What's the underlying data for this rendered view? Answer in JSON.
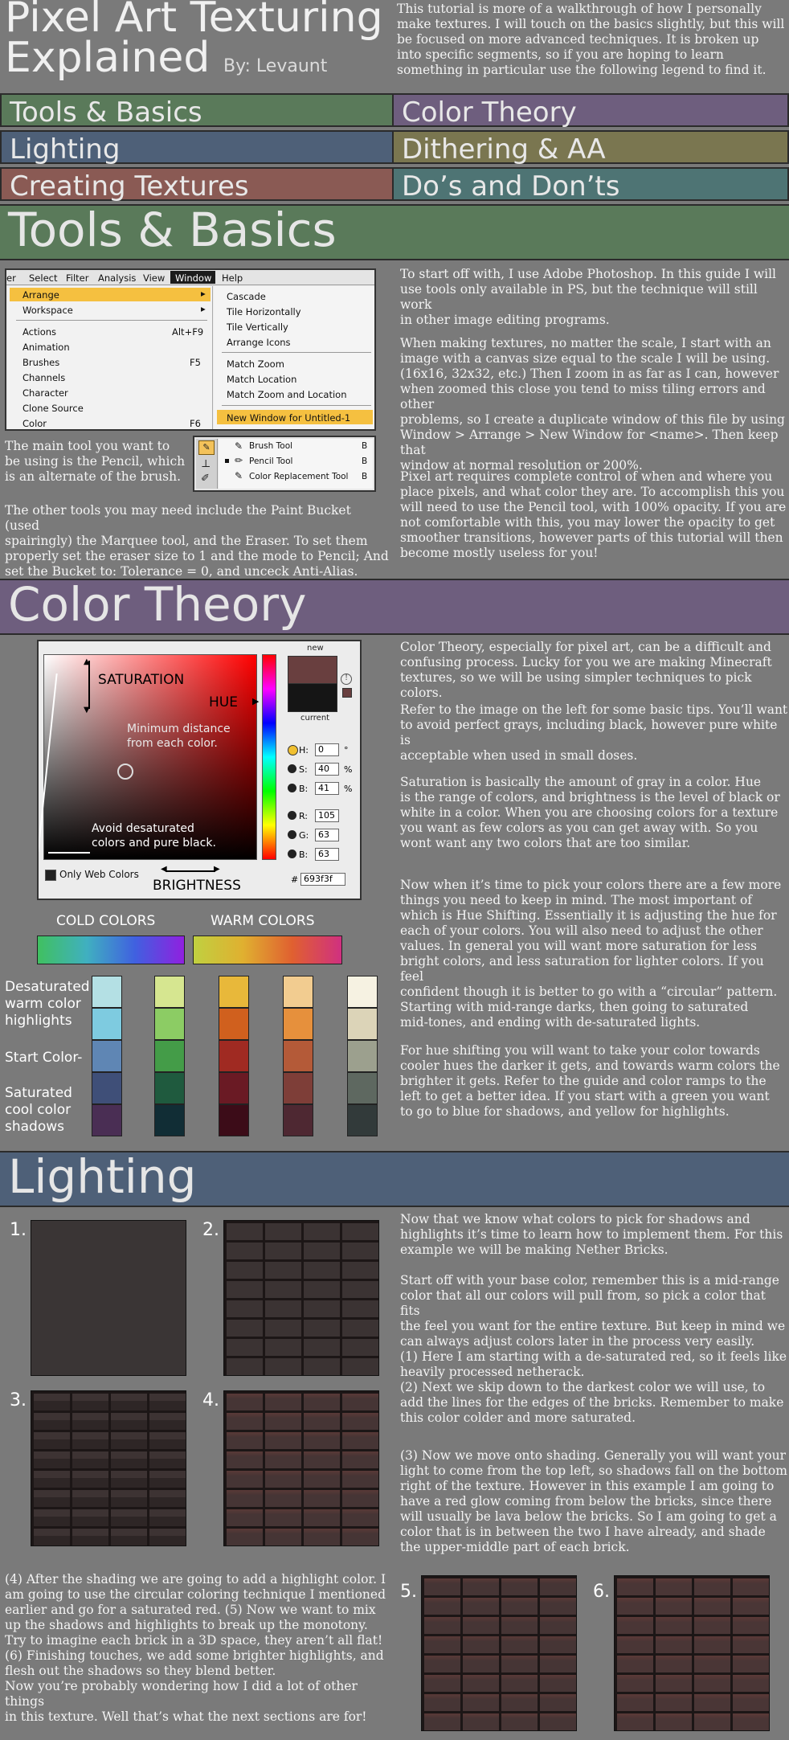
{
  "header": {
    "title_line1": "Pixel Art Texturing",
    "title_line2": "Explained",
    "author": "By: Levaunt",
    "intro": "This tutorial is more of a walkthrough of how I personally make textures. I will touch on the basics slightly, but this will be focused on more advanced techniques. It is broken up into specific segments, so if you are hoping to learn something in particular use the following legend to find it."
  },
  "legend": [
    {
      "label": "Tools & Basics",
      "color": "#5a7a5a"
    },
    {
      "label": "Color Theory",
      "color": "#6e5e7e"
    },
    {
      "label": "Lighting",
      "color": "#4e6078"
    },
    {
      "label": "Dithering & AA",
      "color": "#7a7650"
    },
    {
      "label": "Creating Textures",
      "color": "#8a5a54"
    },
    {
      "label": "Do’s and Don’ts",
      "color": "#4e7474"
    }
  ],
  "tools": {
    "heading": "Tools & Basics",
    "menubar": [
      "er",
      "Select",
      "Filter",
      "Analysis",
      "View",
      "Window",
      "Help"
    ],
    "left_menu": [
      {
        "label": "Arrange",
        "shortcut": ""
      },
      {
        "label": "Workspace",
        "shortcut": ""
      },
      {
        "label": "Actions",
        "shortcut": "Alt+F9"
      },
      {
        "label": "Animation",
        "shortcut": ""
      },
      {
        "label": "Brushes",
        "shortcut": "F5"
      },
      {
        "label": "Channels",
        "shortcut": ""
      },
      {
        "label": "Character",
        "shortcut": ""
      },
      {
        "label": "Clone Source",
        "shortcut": ""
      },
      {
        "label": "Color",
        "shortcut": "F6"
      }
    ],
    "submenu": [
      "Cascade",
      "Tile Horizontally",
      "Tile Vertically",
      "Arrange Icons",
      "Match Zoom",
      "Match Location",
      "Match Zoom and Location",
      "New Window for Untitled-1"
    ],
    "tool_list": [
      {
        "label": "Brush Tool",
        "key": "B"
      },
      {
        "label": "Pencil Tool",
        "key": "B"
      },
      {
        "label": "Color Replacement Tool",
        "key": "B"
      }
    ],
    "pencil_text": "The main tool you want to\nbe using is the Pencil, which\nis an alternate of the brush.",
    "other_tools": "The other tools you may need include the Paint Bucket (used\nspairingly) the Marquee tool, and the Eraser. To set them\nproperly set the eraser size to 1 and the mode to Pencil; And\nset the Bucket to: Tolerance = 0, and unceck Anti-Alias.",
    "right_p1": "To start off with, I use Adobe Photoshop. In this guide I will\nuse tools only available in PS, but the technique will still work\nin other image editing programs.",
    "right_p2": "When making textures, no matter the scale, I start with an\nimage with a canvas size equal to the scale I will be using.\n(16x16, 32x32, etc.) Then I zoom in as far as I can, however\nwhen zoomed this close you tend to miss tiling errors and other\nproblems, so I create a duplicate window of this file by using\nWindow > Arrange > New Window for <name>. Then keep that\nwindow at normal resolution or 200%.",
    "right_p3": "Pixel art requires complete control of when and where you\nplace pixels, and what color they are. To accomplish this you\nwill need to use the Pencil tool, with 100% opacity. If you are\nnot comfortable with this, you may lower the opacity to get\nsmoother transitions, however parts of this tutorial will then\nbecome mostly useless for you!"
  },
  "color": {
    "heading": "Color Theory",
    "picker": {
      "saturation": "SATURATION",
      "hue": "HUE",
      "min_distance": "Minimum distance\nfrom each color.",
      "avoid": "Avoid desaturated\ncolors and pure black.",
      "brightness": "BRIGHTNESS",
      "web_colors": "Only Web Colors",
      "new": "new",
      "current": "current",
      "fields": [
        {
          "label": "H:",
          "value": "0",
          "unit": "°"
        },
        {
          "label": "S:",
          "value": "40",
          "unit": "%"
        },
        {
          "label": "B:",
          "value": "41",
          "unit": "%"
        },
        {
          "label": "R:",
          "value": "105",
          "unit": ""
        },
        {
          "label": "G:",
          "value": "63",
          "unit": ""
        },
        {
          "label": "B:",
          "value": "63",
          "unit": ""
        }
      ],
      "hash": "#",
      "hex": "693f3f",
      "new_color": "#693f3f"
    },
    "cold_label": "COLD COLORS",
    "warm_label": "WARM COLORS",
    "row_labels": {
      "top": "Desaturated\nwarm color\nhighlights",
      "mid": "Start Color-",
      "bottom": "Saturated\ncool color\nshadows"
    },
    "ramps": [
      [
        "#b4e0e4",
        "#7ecbe0",
        "#5f86b4",
        "#3f4f78",
        "#4a2e54"
      ],
      [
        "#d6e690",
        "#8ccc64",
        "#449c48",
        "#1f5a3e",
        "#112d35"
      ],
      [
        "#e8b83a",
        "#d0601e",
        "#a02a22",
        "#6a1a24",
        "#3c0c18"
      ],
      [
        "#f2cc90",
        "#e6903c",
        "#b45a38",
        "#7e3e38",
        "#4e2832"
      ],
      [
        "#f6f2e2",
        "#dcd4b8",
        "#9ca08e",
        "#5e6860",
        "#323a3a"
      ]
    ],
    "p1": "Color Theory, especially for pixel art, can be a difficult and\nconfusing process. Lucky for you we are making Minecraft\ntextures, so we will be using simpler techniques to pick colors.",
    "p2": "Refer to the image on the left for some basic tips. You’ll want\nto avoid perfect grays, including black, however pure white is\nacceptable when used in small doses.",
    "p3": "Saturation is basically the amount of gray in a color. Hue\nis the range of colors, and brightness is the level of black or\nwhite in a color. When you are choosing colors for a texture\nyou want as few colors as you can get away with. So you\nwont want any two colors that are too similar.",
    "p4": "Now when it’s time to pick your colors there are a few more\nthings you need to keep in mind. The most important of\nwhich is Hue Shifting. Essentially it is adjusting the hue for\neach of your colors. You will also need to adjust the other\nvalues. In general you will want more saturation for less\nbright colors, and less saturation for lighter colors. If you feel\nconfident though it is better to go with a “circular” pattern.\nStarting with mid-range darks, then going to saturated\nmid-tones, and ending with de-saturated lights.",
    "p5": "For hue shifting you will want to take your color towards\ncooler hues the darker it gets, and towards warm colors the\nbrighter it gets. Refer to the guide and color ramps to the\nleft to get a better idea. If you start with a green you want\nto go to blue for shadows, and yellow for highlights."
  },
  "lighting": {
    "heading": "Lighting",
    "steps": [
      "1.",
      "2.",
      "3.",
      "4.",
      "5.",
      "6."
    ],
    "p1": "Now that we know what colors to pick for shadows and\nhighlights it’s time to learn how to implement them. For this\nexample we will be making Nether Bricks.",
    "p2": "Start off with your base color, remember this is a mid-range\ncolor that all our colors will pull from, so pick a color that fits\nthe feel you want for the entire texture. But keep in mind we\ncan always adjust colors later in the process very easily.\n(1) Here I am starting with a de-saturated red, so it feels like\nheavily processed netherack.\n(2) Next we skip down to the darkest color we will use, to\nadd the lines for the edges of the bricks. Remember to make\nthis color colder and more saturated.",
    "p3": "(3) Now we move onto shading. Generally you will want your\nlight to come from the top left, so shadows fall on the bottom\nright of the texture. However in this example I am going to\nhave a red glow coming from below the bricks, since there\nwill usually be lava below the bricks. So I am going to get a\ncolor that is in between the two I have already, and shade\nthe upper-middle part of each brick.",
    "p4": "(4) After the shading we are going to add a highlight color. I\nam going to use the circular coloring technique I mentioned\nearlier and go for a saturated red. (5) Now we want to mix\nup the shadows and highlights to break up the monotony.\nTry to imagine each brick in a 3D space, they aren’t all flat!\n(6) Finishing touches, we add some brighter highlights, and\nflesh out the shadows so they blend better.\nNow you’re probably wondering how I did a lot of other things\nin this texture. Well that’s what the next sections are for!"
  }
}
